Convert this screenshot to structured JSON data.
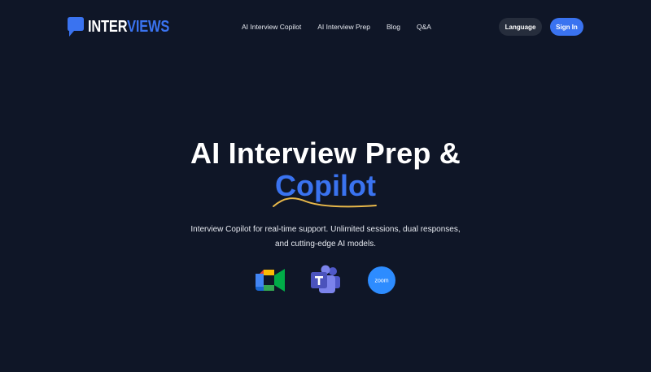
{
  "header": {
    "logo": {
      "text_white": "INTER",
      "text_blue": "VIEWS",
      "icon": "speech-bubble-icon"
    },
    "nav": [
      {
        "label": "AI Interview Copilot"
      },
      {
        "label": "AI Interview Prep"
      },
      {
        "label": "Blog"
      },
      {
        "label": "Q&A"
      }
    ],
    "language_label": "Language",
    "signin_label": "Sign In"
  },
  "hero": {
    "title_line1": "AI Interview Prep &",
    "title_accent": "Copilot",
    "subtitle": "Interview Copilot for real-time support. Unlimited sessions, dual responses, and cutting-edge AI models.",
    "integrations": [
      {
        "name": "google-meet-icon"
      },
      {
        "name": "microsoft-teams-icon"
      },
      {
        "name": "zoom-icon",
        "label": "zoom"
      }
    ]
  },
  "colors": {
    "background": "#0f1627",
    "accent": "#3a73f0",
    "underline": "#e8b84a",
    "language_button": "#262d3c"
  }
}
